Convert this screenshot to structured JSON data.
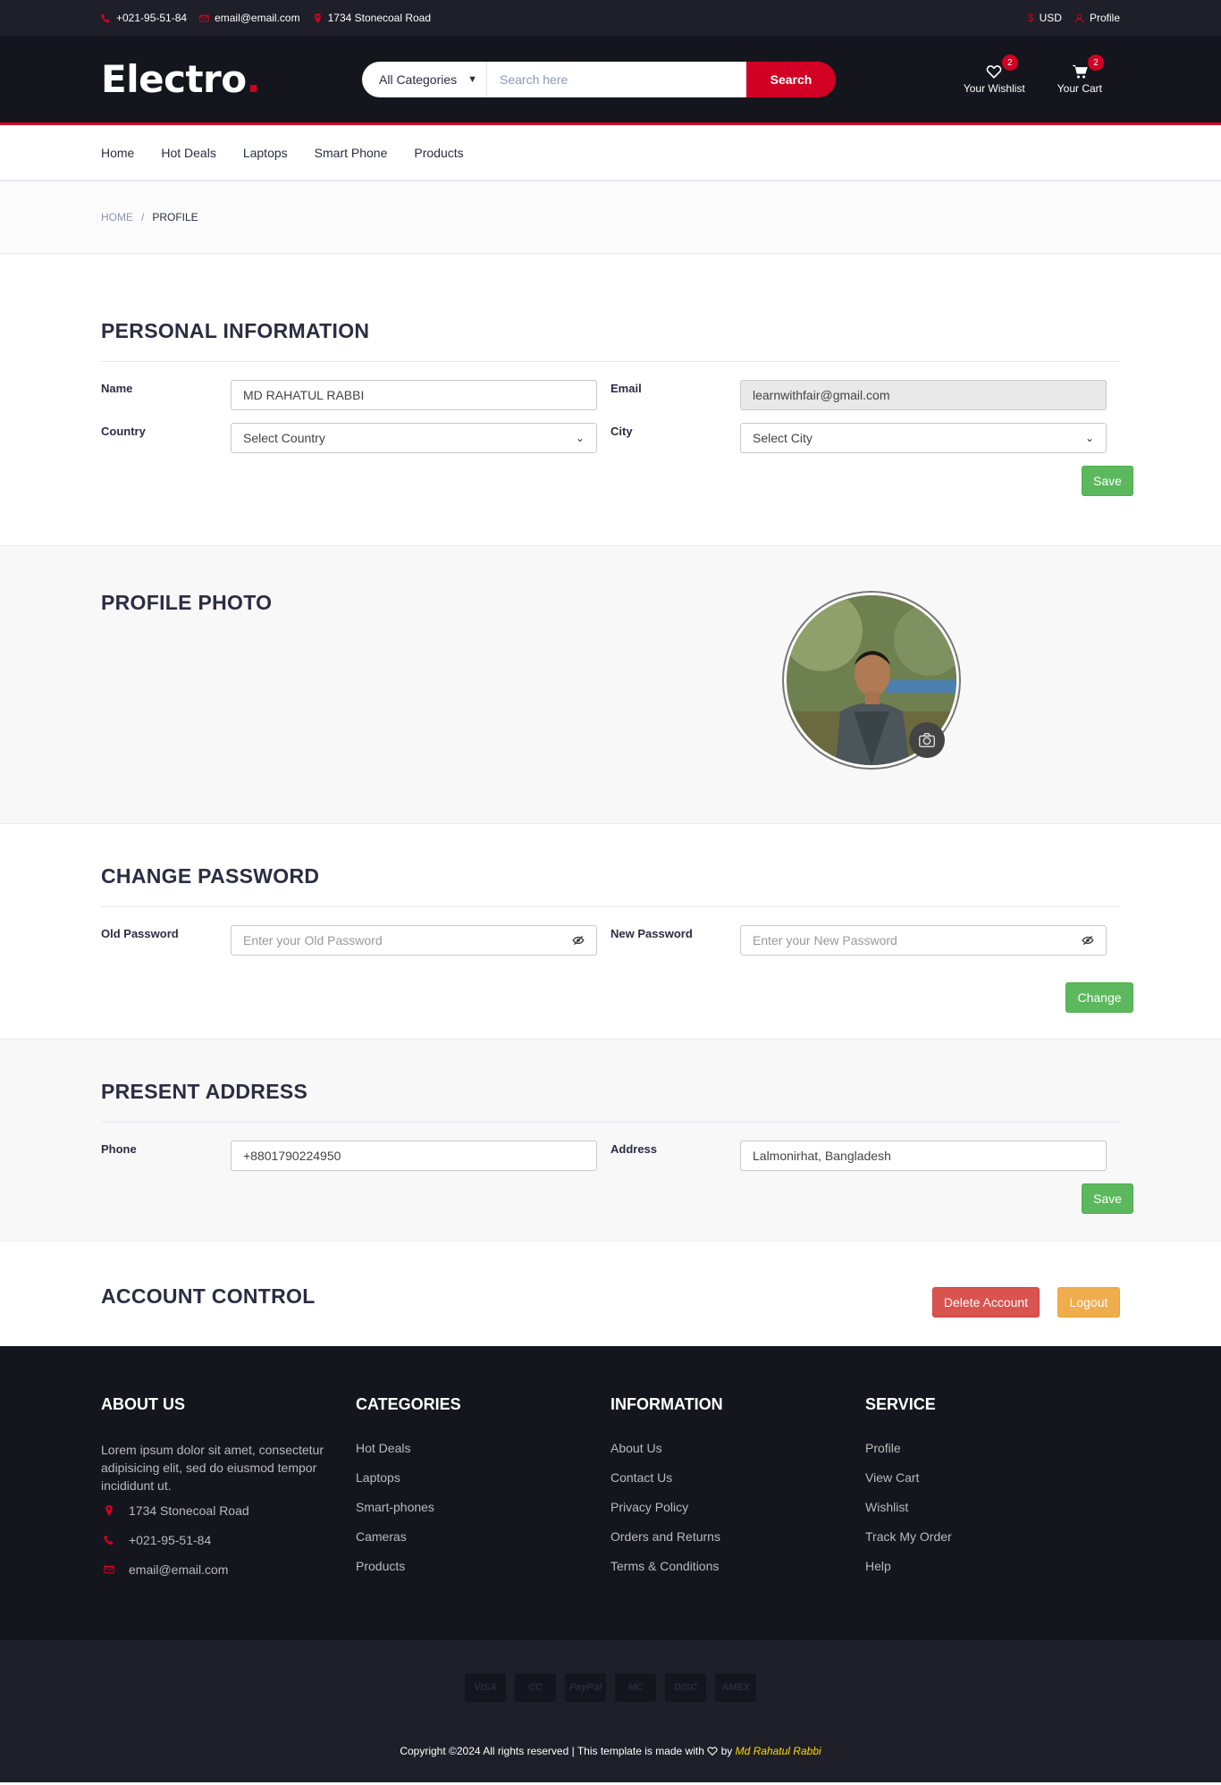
{
  "topbar": {
    "phone": "+021-95-51-84",
    "email": "email@email.com",
    "address": "1734 Stonecoal Road",
    "currency": "USD",
    "profile": "Profile"
  },
  "header": {
    "logo": "Electro",
    "logo_dot": ".",
    "category_select": "All Categories",
    "search_placeholder": "Search here",
    "search_button": "Search",
    "wishlist_label": "Your Wishlist",
    "wishlist_count": "2",
    "cart_label": "Your Cart",
    "cart_count": "2"
  },
  "nav": [
    "Home",
    "Hot Deals",
    "Laptops",
    "Smart Phone",
    "Products"
  ],
  "breadcrumb": {
    "home": "Home",
    "sep": "/",
    "current": "Profile"
  },
  "personal": {
    "title": "Personal Information",
    "name_label": "Name",
    "name_value": "MD RAHATUL RABBI",
    "email_label": "Email",
    "email_value": "learnwithfair@gmail.com",
    "country_label": "Country",
    "country_value": "Select Country",
    "city_label": "City",
    "city_value": "Select City",
    "save": "Save"
  },
  "photo": {
    "title": "Profile Photo"
  },
  "password": {
    "title": "Change Password",
    "old_label": "Old Password",
    "old_placeholder": "Enter your Old Password",
    "new_label": "New Password",
    "new_placeholder": "Enter your New Password",
    "change": "Change"
  },
  "address": {
    "title": "Present Address",
    "phone_label": "Phone",
    "phone_value": "+8801790224950",
    "address_label": "Address",
    "address_value": "Lalmonirhat, Bangladesh",
    "save": "Save"
  },
  "account": {
    "title": "Account Control",
    "delete": "Delete Account",
    "logout": "Logout"
  },
  "footer": {
    "about_title": "About Us",
    "about_text": "Lorem ipsum dolor sit amet, consectetur adipisicing elit, sed do eiusmod tempor incididunt ut.",
    "about_address": "1734 Stonecoal Road",
    "about_phone": "+021-95-51-84",
    "about_email": "email@email.com",
    "categories_title": "Categories",
    "categories": [
      "Hot Deals",
      "Laptops",
      "Smart-phones",
      "Cameras",
      "Products"
    ],
    "info_title": "Information",
    "info": [
      "About Us",
      "Contact Us",
      "Privacy Policy",
      "Orders and Returns",
      "Terms & Conditions"
    ],
    "service_title": "Service",
    "service": [
      "Profile",
      "View Cart",
      "Wishlist",
      "Track My Order",
      "Help"
    ],
    "payments": [
      "VISA",
      "CC",
      "PayPal",
      "MC",
      "DISC",
      "AMEX"
    ],
    "copyright": "Copyright ©2024 All rights reserved | This template is made with",
    "by": "by",
    "author": "Md Rahatul Rabbi"
  },
  "colors": {
    "brand": "#d10024",
    "dark": "#15161d",
    "success": "#5cb85c",
    "danger": "#d9534f",
    "warning": "#f0ad4e"
  }
}
